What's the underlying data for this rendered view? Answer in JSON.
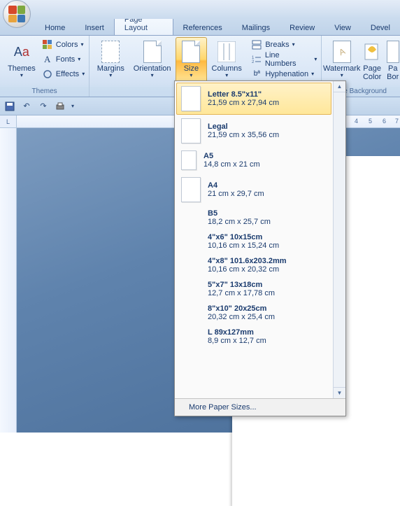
{
  "tabs": {
    "home": "Home",
    "insert": "Insert",
    "page_layout": "Page Layout",
    "references": "References",
    "mailings": "Mailings",
    "review": "Review",
    "view": "View",
    "developer": "Devel"
  },
  "ribbon": {
    "themes": {
      "label": "Themes",
      "themes_btn": "Themes",
      "colors": "Colors",
      "fonts": "Fonts",
      "effects": "Effects"
    },
    "page_setup": {
      "margins": "Margins",
      "orientation": "Orientation",
      "size": "Size",
      "columns": "Columns",
      "breaks": "Breaks",
      "line_numbers": "Line Numbers",
      "hyphenation": "Hyphenation"
    },
    "page_background": {
      "label": "ge Background",
      "watermark": "Watermark",
      "page_color": "Page\nColor",
      "page_borders": "Pa\nBor"
    }
  },
  "ruler": {
    "corner": "L",
    "marks": [
      "4",
      "5",
      "6",
      "7"
    ]
  },
  "gallery": {
    "items": [
      {
        "name": "Letter 8.5\"x11\"",
        "dim": "21,59 cm x 27,94 cm"
      },
      {
        "name": "Legal",
        "dim": "21,59 cm x 35,56 cm"
      },
      {
        "name": "A5",
        "dim": "14,8 cm x 21 cm"
      },
      {
        "name": "A4",
        "dim": "21 cm x 29,7 cm"
      },
      {
        "name": "B5",
        "dim": "18,2 cm x 25,7 cm"
      },
      {
        "name": "4\"x6\" 10x15cm",
        "dim": "10,16 cm x 15,24 cm"
      },
      {
        "name": "4\"x8\" 101.6x203.2mm",
        "dim": "10,16 cm x 20,32 cm"
      },
      {
        "name": "5\"x7\" 13x18cm",
        "dim": "12,7 cm x 17,78 cm"
      },
      {
        "name": "8\"x10\" 20x25cm",
        "dim": "20,32 cm x 25,4 cm"
      },
      {
        "name": "L 89x127mm",
        "dim": "8,9 cm x 12,7 cm"
      }
    ],
    "more": "More Paper Sizes..."
  }
}
